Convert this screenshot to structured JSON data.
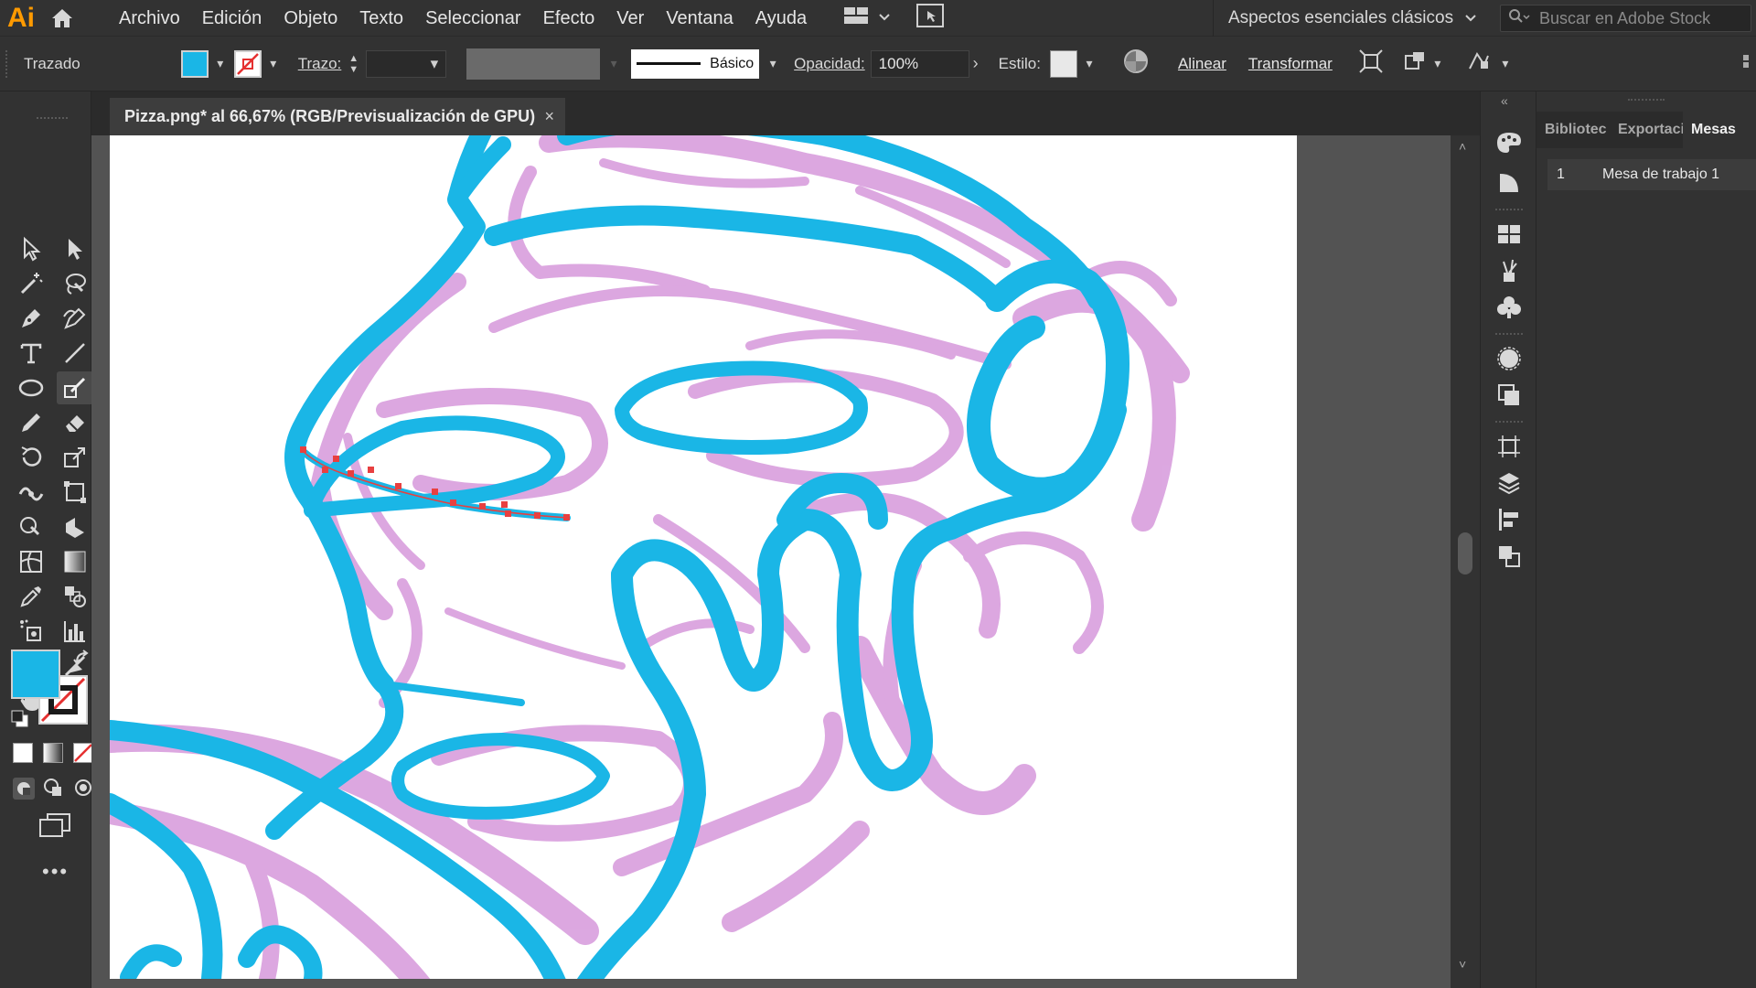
{
  "app": {
    "logo": "Ai"
  },
  "menu": [
    "Archivo",
    "Edición",
    "Objeto",
    "Texto",
    "Seleccionar",
    "Efecto",
    "Ver",
    "Ventana",
    "Ayuda"
  ],
  "workspace": {
    "label": "Aspectos esenciales clásicos"
  },
  "search": {
    "placeholder": "Buscar en Adobe Stock"
  },
  "control": {
    "selection_type": "Trazado",
    "stroke_label": "Trazo:",
    "brush_label": "Básico",
    "opacity_label": "Opacidad:",
    "opacity_value": "100%",
    "style_label": "Estilo:",
    "align_label": "Alinear",
    "transform_label": "Transformar"
  },
  "document": {
    "tab_title": "Pizza.png* al 66,67% (RGB/Previsualización de GPU)",
    "close": "×"
  },
  "panel": {
    "tabs": [
      "Bibliotec",
      "Exportaci",
      "Mesas"
    ],
    "active_tab": 2,
    "artboards": [
      {
        "number": "1",
        "name": "Mesa de trabajo 1"
      }
    ]
  },
  "colors": {
    "fill": "#1ab6e6",
    "sketch": "#c060c8",
    "path": "#e84040",
    "accent_logo": "#ff9a00"
  }
}
